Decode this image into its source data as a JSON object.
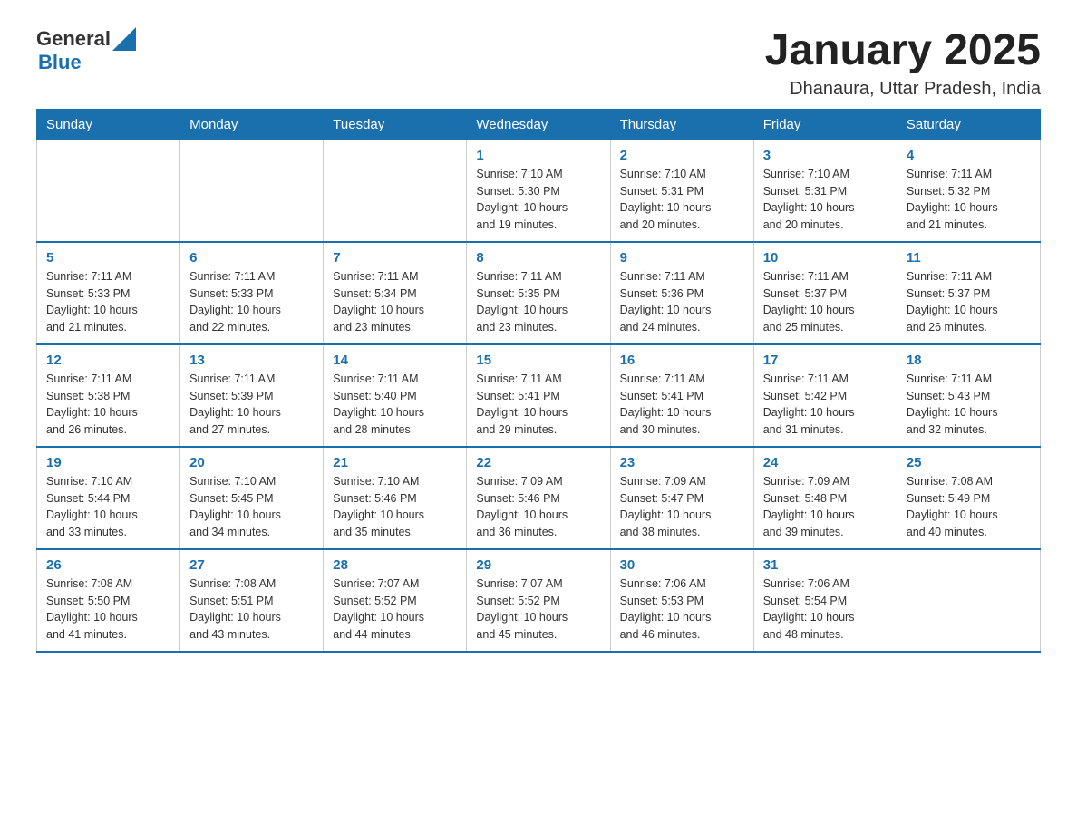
{
  "header": {
    "logo_general": "General",
    "logo_blue": "Blue",
    "title": "January 2025",
    "subtitle": "Dhanaura, Uttar Pradesh, India"
  },
  "weekdays": [
    "Sunday",
    "Monday",
    "Tuesday",
    "Wednesday",
    "Thursday",
    "Friday",
    "Saturday"
  ],
  "weeks": [
    [
      {
        "day": "",
        "info": ""
      },
      {
        "day": "",
        "info": ""
      },
      {
        "day": "",
        "info": ""
      },
      {
        "day": "1",
        "info": "Sunrise: 7:10 AM\nSunset: 5:30 PM\nDaylight: 10 hours\nand 19 minutes."
      },
      {
        "day": "2",
        "info": "Sunrise: 7:10 AM\nSunset: 5:31 PM\nDaylight: 10 hours\nand 20 minutes."
      },
      {
        "day": "3",
        "info": "Sunrise: 7:10 AM\nSunset: 5:31 PM\nDaylight: 10 hours\nand 20 minutes."
      },
      {
        "day": "4",
        "info": "Sunrise: 7:11 AM\nSunset: 5:32 PM\nDaylight: 10 hours\nand 21 minutes."
      }
    ],
    [
      {
        "day": "5",
        "info": "Sunrise: 7:11 AM\nSunset: 5:33 PM\nDaylight: 10 hours\nand 21 minutes."
      },
      {
        "day": "6",
        "info": "Sunrise: 7:11 AM\nSunset: 5:33 PM\nDaylight: 10 hours\nand 22 minutes."
      },
      {
        "day": "7",
        "info": "Sunrise: 7:11 AM\nSunset: 5:34 PM\nDaylight: 10 hours\nand 23 minutes."
      },
      {
        "day": "8",
        "info": "Sunrise: 7:11 AM\nSunset: 5:35 PM\nDaylight: 10 hours\nand 23 minutes."
      },
      {
        "day": "9",
        "info": "Sunrise: 7:11 AM\nSunset: 5:36 PM\nDaylight: 10 hours\nand 24 minutes."
      },
      {
        "day": "10",
        "info": "Sunrise: 7:11 AM\nSunset: 5:37 PM\nDaylight: 10 hours\nand 25 minutes."
      },
      {
        "day": "11",
        "info": "Sunrise: 7:11 AM\nSunset: 5:37 PM\nDaylight: 10 hours\nand 26 minutes."
      }
    ],
    [
      {
        "day": "12",
        "info": "Sunrise: 7:11 AM\nSunset: 5:38 PM\nDaylight: 10 hours\nand 26 minutes."
      },
      {
        "day": "13",
        "info": "Sunrise: 7:11 AM\nSunset: 5:39 PM\nDaylight: 10 hours\nand 27 minutes."
      },
      {
        "day": "14",
        "info": "Sunrise: 7:11 AM\nSunset: 5:40 PM\nDaylight: 10 hours\nand 28 minutes."
      },
      {
        "day": "15",
        "info": "Sunrise: 7:11 AM\nSunset: 5:41 PM\nDaylight: 10 hours\nand 29 minutes."
      },
      {
        "day": "16",
        "info": "Sunrise: 7:11 AM\nSunset: 5:41 PM\nDaylight: 10 hours\nand 30 minutes."
      },
      {
        "day": "17",
        "info": "Sunrise: 7:11 AM\nSunset: 5:42 PM\nDaylight: 10 hours\nand 31 minutes."
      },
      {
        "day": "18",
        "info": "Sunrise: 7:11 AM\nSunset: 5:43 PM\nDaylight: 10 hours\nand 32 minutes."
      }
    ],
    [
      {
        "day": "19",
        "info": "Sunrise: 7:10 AM\nSunset: 5:44 PM\nDaylight: 10 hours\nand 33 minutes."
      },
      {
        "day": "20",
        "info": "Sunrise: 7:10 AM\nSunset: 5:45 PM\nDaylight: 10 hours\nand 34 minutes."
      },
      {
        "day": "21",
        "info": "Sunrise: 7:10 AM\nSunset: 5:46 PM\nDaylight: 10 hours\nand 35 minutes."
      },
      {
        "day": "22",
        "info": "Sunrise: 7:09 AM\nSunset: 5:46 PM\nDaylight: 10 hours\nand 36 minutes."
      },
      {
        "day": "23",
        "info": "Sunrise: 7:09 AM\nSunset: 5:47 PM\nDaylight: 10 hours\nand 38 minutes."
      },
      {
        "day": "24",
        "info": "Sunrise: 7:09 AM\nSunset: 5:48 PM\nDaylight: 10 hours\nand 39 minutes."
      },
      {
        "day": "25",
        "info": "Sunrise: 7:08 AM\nSunset: 5:49 PM\nDaylight: 10 hours\nand 40 minutes."
      }
    ],
    [
      {
        "day": "26",
        "info": "Sunrise: 7:08 AM\nSunset: 5:50 PM\nDaylight: 10 hours\nand 41 minutes."
      },
      {
        "day": "27",
        "info": "Sunrise: 7:08 AM\nSunset: 5:51 PM\nDaylight: 10 hours\nand 43 minutes."
      },
      {
        "day": "28",
        "info": "Sunrise: 7:07 AM\nSunset: 5:52 PM\nDaylight: 10 hours\nand 44 minutes."
      },
      {
        "day": "29",
        "info": "Sunrise: 7:07 AM\nSunset: 5:52 PM\nDaylight: 10 hours\nand 45 minutes."
      },
      {
        "day": "30",
        "info": "Sunrise: 7:06 AM\nSunset: 5:53 PM\nDaylight: 10 hours\nand 46 minutes."
      },
      {
        "day": "31",
        "info": "Sunrise: 7:06 AM\nSunset: 5:54 PM\nDaylight: 10 hours\nand 48 minutes."
      },
      {
        "day": "",
        "info": ""
      }
    ]
  ]
}
